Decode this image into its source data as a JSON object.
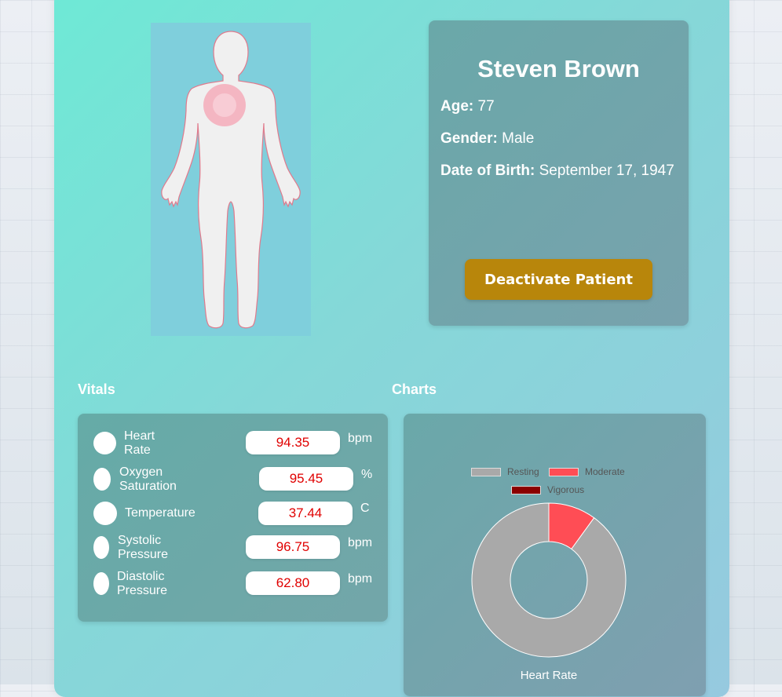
{
  "patient": {
    "name": "Steven Brown",
    "age_label": "Age:",
    "age": "77",
    "gender_label": "Gender:",
    "gender": "Male",
    "dob_label": "Date of Birth:",
    "dob": "September 17, 1947",
    "deactivate_label": "Deactivate Patient"
  },
  "sections": {
    "vitals": "Vitals",
    "charts": "Charts"
  },
  "vitals": [
    {
      "label": "Heart\nRate",
      "value": "94.35",
      "unit": "bpm"
    },
    {
      "label": "Oxygen\nSaturation",
      "value": "95.45",
      "unit": "%"
    },
    {
      "label": "Temperature",
      "value": "37.44",
      "unit": "C"
    },
    {
      "label": "Systolic\nPressure",
      "value": "96.75",
      "unit": "bpm"
    },
    {
      "label": "Diastolic\nPressure",
      "value": "62.80",
      "unit": "bpm"
    }
  ],
  "colors": {
    "accent_button": "#b8860b",
    "vital_value_text": "#e00000",
    "heart_highlight": "#f4b6c2"
  },
  "chart_data": {
    "type": "doughnut",
    "title": "Heart Rate",
    "legend_position": "top",
    "series": [
      {
        "name": "Resting",
        "value": 90,
        "color": "#a9a9a9"
      },
      {
        "name": "Moderate",
        "value": 10,
        "color": "#ff4d55"
      },
      {
        "name": "Vigorous",
        "value": 0,
        "color": "#8b0000"
      }
    ]
  }
}
